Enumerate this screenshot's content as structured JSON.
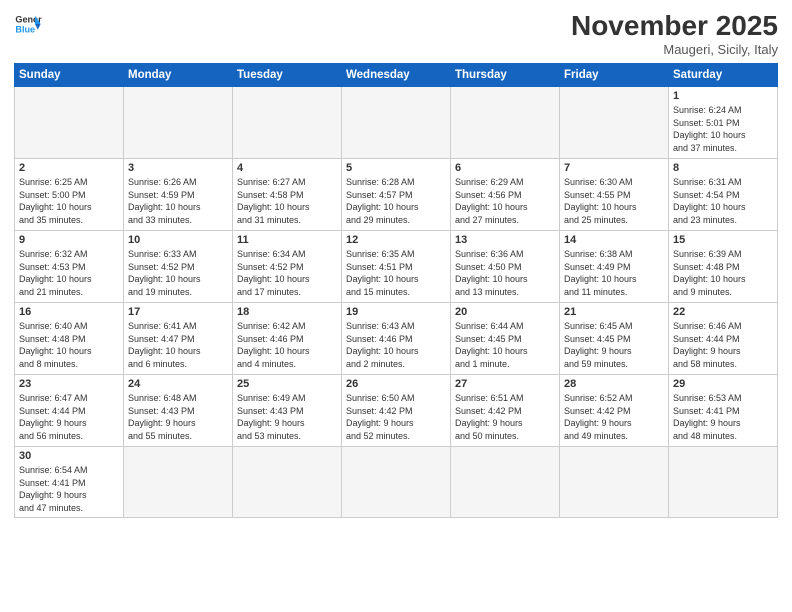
{
  "header": {
    "logo_general": "General",
    "logo_blue": "Blue",
    "month_title": "November 2025",
    "subtitle": "Maugeri, Sicily, Italy"
  },
  "weekdays": [
    "Sunday",
    "Monday",
    "Tuesday",
    "Wednesday",
    "Thursday",
    "Friday",
    "Saturday"
  ],
  "weeks": [
    [
      {
        "day": "",
        "info": ""
      },
      {
        "day": "",
        "info": ""
      },
      {
        "day": "",
        "info": ""
      },
      {
        "day": "",
        "info": ""
      },
      {
        "day": "",
        "info": ""
      },
      {
        "day": "",
        "info": ""
      },
      {
        "day": "1",
        "info": "Sunrise: 6:24 AM\nSunset: 5:01 PM\nDaylight: 10 hours\nand 37 minutes."
      }
    ],
    [
      {
        "day": "2",
        "info": "Sunrise: 6:25 AM\nSunset: 5:00 PM\nDaylight: 10 hours\nand 35 minutes."
      },
      {
        "day": "3",
        "info": "Sunrise: 6:26 AM\nSunset: 4:59 PM\nDaylight: 10 hours\nand 33 minutes."
      },
      {
        "day": "4",
        "info": "Sunrise: 6:27 AM\nSunset: 4:58 PM\nDaylight: 10 hours\nand 31 minutes."
      },
      {
        "day": "5",
        "info": "Sunrise: 6:28 AM\nSunset: 4:57 PM\nDaylight: 10 hours\nand 29 minutes."
      },
      {
        "day": "6",
        "info": "Sunrise: 6:29 AM\nSunset: 4:56 PM\nDaylight: 10 hours\nand 27 minutes."
      },
      {
        "day": "7",
        "info": "Sunrise: 6:30 AM\nSunset: 4:55 PM\nDaylight: 10 hours\nand 25 minutes."
      },
      {
        "day": "8",
        "info": "Sunrise: 6:31 AM\nSunset: 4:54 PM\nDaylight: 10 hours\nand 23 minutes."
      }
    ],
    [
      {
        "day": "9",
        "info": "Sunrise: 6:32 AM\nSunset: 4:53 PM\nDaylight: 10 hours\nand 21 minutes."
      },
      {
        "day": "10",
        "info": "Sunrise: 6:33 AM\nSunset: 4:52 PM\nDaylight: 10 hours\nand 19 minutes."
      },
      {
        "day": "11",
        "info": "Sunrise: 6:34 AM\nSunset: 4:52 PM\nDaylight: 10 hours\nand 17 minutes."
      },
      {
        "day": "12",
        "info": "Sunrise: 6:35 AM\nSunset: 4:51 PM\nDaylight: 10 hours\nand 15 minutes."
      },
      {
        "day": "13",
        "info": "Sunrise: 6:36 AM\nSunset: 4:50 PM\nDaylight: 10 hours\nand 13 minutes."
      },
      {
        "day": "14",
        "info": "Sunrise: 6:38 AM\nSunset: 4:49 PM\nDaylight: 10 hours\nand 11 minutes."
      },
      {
        "day": "15",
        "info": "Sunrise: 6:39 AM\nSunset: 4:48 PM\nDaylight: 10 hours\nand 9 minutes."
      }
    ],
    [
      {
        "day": "16",
        "info": "Sunrise: 6:40 AM\nSunset: 4:48 PM\nDaylight: 10 hours\nand 8 minutes."
      },
      {
        "day": "17",
        "info": "Sunrise: 6:41 AM\nSunset: 4:47 PM\nDaylight: 10 hours\nand 6 minutes."
      },
      {
        "day": "18",
        "info": "Sunrise: 6:42 AM\nSunset: 4:46 PM\nDaylight: 10 hours\nand 4 minutes."
      },
      {
        "day": "19",
        "info": "Sunrise: 6:43 AM\nSunset: 4:46 PM\nDaylight: 10 hours\nand 2 minutes."
      },
      {
        "day": "20",
        "info": "Sunrise: 6:44 AM\nSunset: 4:45 PM\nDaylight: 10 hours\nand 1 minute."
      },
      {
        "day": "21",
        "info": "Sunrise: 6:45 AM\nSunset: 4:45 PM\nDaylight: 9 hours\nand 59 minutes."
      },
      {
        "day": "22",
        "info": "Sunrise: 6:46 AM\nSunset: 4:44 PM\nDaylight: 9 hours\nand 58 minutes."
      }
    ],
    [
      {
        "day": "23",
        "info": "Sunrise: 6:47 AM\nSunset: 4:44 PM\nDaylight: 9 hours\nand 56 minutes."
      },
      {
        "day": "24",
        "info": "Sunrise: 6:48 AM\nSunset: 4:43 PM\nDaylight: 9 hours\nand 55 minutes."
      },
      {
        "day": "25",
        "info": "Sunrise: 6:49 AM\nSunset: 4:43 PM\nDaylight: 9 hours\nand 53 minutes."
      },
      {
        "day": "26",
        "info": "Sunrise: 6:50 AM\nSunset: 4:42 PM\nDaylight: 9 hours\nand 52 minutes."
      },
      {
        "day": "27",
        "info": "Sunrise: 6:51 AM\nSunset: 4:42 PM\nDaylight: 9 hours\nand 50 minutes."
      },
      {
        "day": "28",
        "info": "Sunrise: 6:52 AM\nSunset: 4:42 PM\nDaylight: 9 hours\nand 49 minutes."
      },
      {
        "day": "29",
        "info": "Sunrise: 6:53 AM\nSunset: 4:41 PM\nDaylight: 9 hours\nand 48 minutes."
      }
    ],
    [
      {
        "day": "30",
        "info": "Sunrise: 6:54 AM\nSunset: 4:41 PM\nDaylight: 9 hours\nand 47 minutes."
      },
      {
        "day": "",
        "info": ""
      },
      {
        "day": "",
        "info": ""
      },
      {
        "day": "",
        "info": ""
      },
      {
        "day": "",
        "info": ""
      },
      {
        "day": "",
        "info": ""
      },
      {
        "day": "",
        "info": ""
      }
    ]
  ]
}
